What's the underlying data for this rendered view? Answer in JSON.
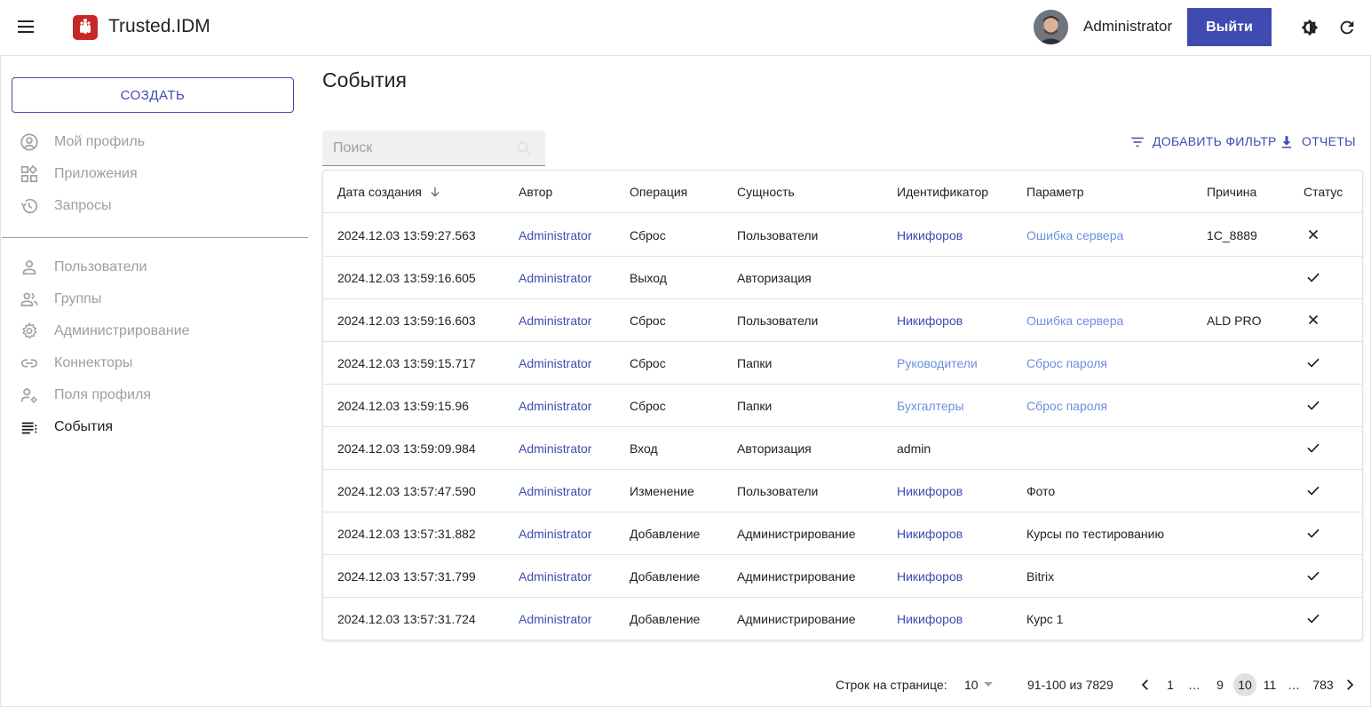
{
  "header": {
    "brand": "Trusted.IDM",
    "username": "Administrator",
    "logout_label": "Выйти"
  },
  "sidebar": {
    "create_label": "СОЗДАТЬ",
    "top_items": [
      {
        "label": "Мой профиль",
        "icon": "account-circle-icon"
      },
      {
        "label": "Приложения",
        "icon": "apps-icon"
      },
      {
        "label": "Запросы",
        "icon": "history-icon"
      }
    ],
    "bottom_items": [
      {
        "label": "Пользователи",
        "icon": "person-icon"
      },
      {
        "label": "Группы",
        "icon": "group-icon"
      },
      {
        "label": "Администрирование",
        "icon": "gear-icon"
      },
      {
        "label": "Коннекторы",
        "icon": "link-icon"
      },
      {
        "label": "Поля профиля",
        "icon": "manage-accounts-icon"
      },
      {
        "label": "События",
        "icon": "list-icon",
        "active": true
      }
    ]
  },
  "main": {
    "title": "События",
    "search_placeholder": "Поиск",
    "add_filter_label": "ДОБАВИТЬ ФИЛЬТР",
    "reports_label": "ОТЧЕТЫ",
    "columns": [
      "Дата создания",
      "Автор",
      "Операция",
      "Сущность",
      "Идентификатор",
      "Параметр",
      "Причина",
      "Статус"
    ],
    "rows": [
      {
        "date": "2024.12.03 13:59:27.563",
        "author": "Administrator",
        "operation": "Сброс",
        "entity": "Пользователи",
        "identifier": "Никифоров",
        "identifier_style": "dark",
        "param": "Ошибка сервера",
        "param_style": "light",
        "reason": "1C_8889",
        "status": "error"
      },
      {
        "date": "2024.12.03 13:59:16.605",
        "author": "Administrator",
        "operation": "Выход",
        "entity": "Авторизация",
        "identifier": "",
        "identifier_style": "plain",
        "param": "",
        "param_style": "plain",
        "reason": "",
        "status": "ok"
      },
      {
        "date": "2024.12.03 13:59:16.603",
        "author": "Administrator",
        "operation": "Сброс",
        "entity": "Пользователи",
        "identifier": "Никифоров",
        "identifier_style": "dark",
        "param": "Ошибка сервера",
        "param_style": "light",
        "reason": "ALD PRO",
        "status": "error"
      },
      {
        "date": "2024.12.03 13:59:15.717",
        "author": "Administrator",
        "operation": "Сброс",
        "entity": "Папки",
        "identifier": "Руководители",
        "identifier_style": "light",
        "param": "Сброс пароля",
        "param_style": "light",
        "reason": "",
        "status": "ok"
      },
      {
        "date": "2024.12.03 13:59:15.96",
        "author": "Administrator",
        "operation": "Сброс",
        "entity": "Папки",
        "identifier": "Бухгалтеры",
        "identifier_style": "light",
        "param": "Сброс пароля",
        "param_style": "light",
        "reason": "",
        "status": "ok"
      },
      {
        "date": "2024.12.03 13:59:09.984",
        "author": "Administrator",
        "operation": "Вход",
        "entity": "Авторизация",
        "identifier": "admin",
        "identifier_style": "plain",
        "param": "",
        "param_style": "plain",
        "reason": "",
        "status": "ok"
      },
      {
        "date": "2024.12.03 13:57:47.590",
        "author": "Administrator",
        "operation": "Изменение",
        "entity": "Пользователи",
        "identifier": "Никифоров",
        "identifier_style": "dark",
        "param": "Фото",
        "param_style": "plain",
        "reason": "",
        "status": "ok"
      },
      {
        "date": "2024.12.03 13:57:31.882",
        "author": "Administrator",
        "operation": "Добавление",
        "entity": "Администрирование",
        "identifier": "Никифоров",
        "identifier_style": "dark",
        "param": "Курсы по тестированию",
        "param_style": "plain",
        "reason": "",
        "status": "ok"
      },
      {
        "date": "2024.12.03 13:57:31.799",
        "author": "Administrator",
        "operation": "Добавление",
        "entity": "Администрирование",
        "identifier": "Никифоров",
        "identifier_style": "dark",
        "param": "Bitrix",
        "param_style": "plain",
        "reason": "",
        "status": "ok"
      },
      {
        "date": "2024.12.03 13:57:31.724",
        "author": "Administrator",
        "operation": "Добавление",
        "entity": "Администрирование",
        "identifier": "Никифоров",
        "identifier_style": "dark",
        "param": "Курс 1",
        "param_style": "plain",
        "reason": "",
        "status": "ok"
      }
    ]
  },
  "pagination": {
    "rows_per_page_label": "Строк на странице:",
    "rows_per_page": "10",
    "range": "91-100 из 7829",
    "pages": [
      {
        "label": "1"
      },
      {
        "label": "…",
        "ellipsis": true
      },
      {
        "label": "9"
      },
      {
        "label": "10",
        "current": true
      },
      {
        "label": "11"
      },
      {
        "label": "…",
        "ellipsis": true
      },
      {
        "label": "783"
      }
    ]
  },
  "colors": {
    "accent": "#3f4bb0",
    "link_light": "#6c8ee0",
    "logo": "#c62828"
  }
}
